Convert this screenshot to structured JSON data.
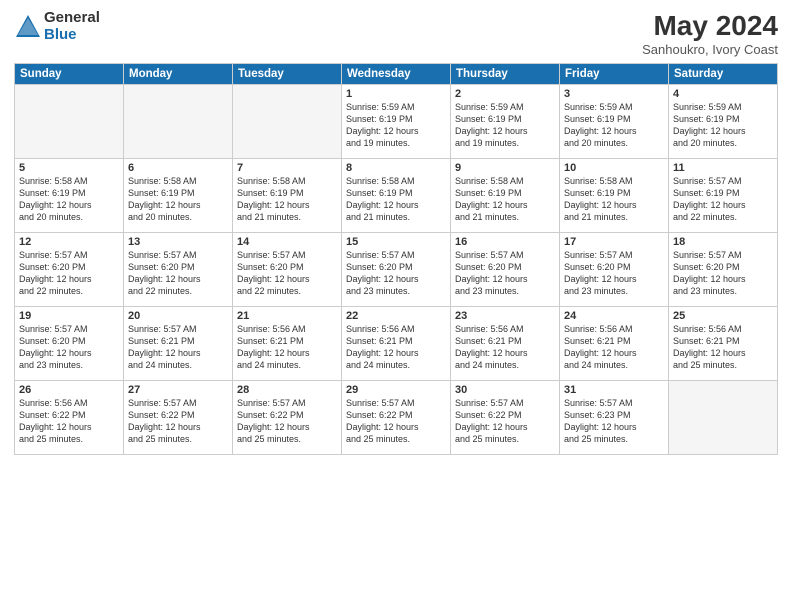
{
  "logo": {
    "general": "General",
    "blue": "Blue"
  },
  "title": "May 2024",
  "subtitle": "Sanhoukro, Ivory Coast",
  "days_header": [
    "Sunday",
    "Monday",
    "Tuesday",
    "Wednesday",
    "Thursday",
    "Friday",
    "Saturday"
  ],
  "weeks": [
    [
      {
        "num": "",
        "info": ""
      },
      {
        "num": "",
        "info": ""
      },
      {
        "num": "",
        "info": ""
      },
      {
        "num": "1",
        "info": "Sunrise: 5:59 AM\nSunset: 6:19 PM\nDaylight: 12 hours\nand 19 minutes."
      },
      {
        "num": "2",
        "info": "Sunrise: 5:59 AM\nSunset: 6:19 PM\nDaylight: 12 hours\nand 19 minutes."
      },
      {
        "num": "3",
        "info": "Sunrise: 5:59 AM\nSunset: 6:19 PM\nDaylight: 12 hours\nand 20 minutes."
      },
      {
        "num": "4",
        "info": "Sunrise: 5:59 AM\nSunset: 6:19 PM\nDaylight: 12 hours\nand 20 minutes."
      }
    ],
    [
      {
        "num": "5",
        "info": "Sunrise: 5:58 AM\nSunset: 6:19 PM\nDaylight: 12 hours\nand 20 minutes."
      },
      {
        "num": "6",
        "info": "Sunrise: 5:58 AM\nSunset: 6:19 PM\nDaylight: 12 hours\nand 20 minutes."
      },
      {
        "num": "7",
        "info": "Sunrise: 5:58 AM\nSunset: 6:19 PM\nDaylight: 12 hours\nand 21 minutes."
      },
      {
        "num": "8",
        "info": "Sunrise: 5:58 AM\nSunset: 6:19 PM\nDaylight: 12 hours\nand 21 minutes."
      },
      {
        "num": "9",
        "info": "Sunrise: 5:58 AM\nSunset: 6:19 PM\nDaylight: 12 hours\nand 21 minutes."
      },
      {
        "num": "10",
        "info": "Sunrise: 5:58 AM\nSunset: 6:19 PM\nDaylight: 12 hours\nand 21 minutes."
      },
      {
        "num": "11",
        "info": "Sunrise: 5:57 AM\nSunset: 6:19 PM\nDaylight: 12 hours\nand 22 minutes."
      }
    ],
    [
      {
        "num": "12",
        "info": "Sunrise: 5:57 AM\nSunset: 6:20 PM\nDaylight: 12 hours\nand 22 minutes."
      },
      {
        "num": "13",
        "info": "Sunrise: 5:57 AM\nSunset: 6:20 PM\nDaylight: 12 hours\nand 22 minutes."
      },
      {
        "num": "14",
        "info": "Sunrise: 5:57 AM\nSunset: 6:20 PM\nDaylight: 12 hours\nand 22 minutes."
      },
      {
        "num": "15",
        "info": "Sunrise: 5:57 AM\nSunset: 6:20 PM\nDaylight: 12 hours\nand 23 minutes."
      },
      {
        "num": "16",
        "info": "Sunrise: 5:57 AM\nSunset: 6:20 PM\nDaylight: 12 hours\nand 23 minutes."
      },
      {
        "num": "17",
        "info": "Sunrise: 5:57 AM\nSunset: 6:20 PM\nDaylight: 12 hours\nand 23 minutes."
      },
      {
        "num": "18",
        "info": "Sunrise: 5:57 AM\nSunset: 6:20 PM\nDaylight: 12 hours\nand 23 minutes."
      }
    ],
    [
      {
        "num": "19",
        "info": "Sunrise: 5:57 AM\nSunset: 6:20 PM\nDaylight: 12 hours\nand 23 minutes."
      },
      {
        "num": "20",
        "info": "Sunrise: 5:57 AM\nSunset: 6:21 PM\nDaylight: 12 hours\nand 24 minutes."
      },
      {
        "num": "21",
        "info": "Sunrise: 5:56 AM\nSunset: 6:21 PM\nDaylight: 12 hours\nand 24 minutes."
      },
      {
        "num": "22",
        "info": "Sunrise: 5:56 AM\nSunset: 6:21 PM\nDaylight: 12 hours\nand 24 minutes."
      },
      {
        "num": "23",
        "info": "Sunrise: 5:56 AM\nSunset: 6:21 PM\nDaylight: 12 hours\nand 24 minutes."
      },
      {
        "num": "24",
        "info": "Sunrise: 5:56 AM\nSunset: 6:21 PM\nDaylight: 12 hours\nand 24 minutes."
      },
      {
        "num": "25",
        "info": "Sunrise: 5:56 AM\nSunset: 6:21 PM\nDaylight: 12 hours\nand 25 minutes."
      }
    ],
    [
      {
        "num": "26",
        "info": "Sunrise: 5:56 AM\nSunset: 6:22 PM\nDaylight: 12 hours\nand 25 minutes."
      },
      {
        "num": "27",
        "info": "Sunrise: 5:57 AM\nSunset: 6:22 PM\nDaylight: 12 hours\nand 25 minutes."
      },
      {
        "num": "28",
        "info": "Sunrise: 5:57 AM\nSunset: 6:22 PM\nDaylight: 12 hours\nand 25 minutes."
      },
      {
        "num": "29",
        "info": "Sunrise: 5:57 AM\nSunset: 6:22 PM\nDaylight: 12 hours\nand 25 minutes."
      },
      {
        "num": "30",
        "info": "Sunrise: 5:57 AM\nSunset: 6:22 PM\nDaylight: 12 hours\nand 25 minutes."
      },
      {
        "num": "31",
        "info": "Sunrise: 5:57 AM\nSunset: 6:23 PM\nDaylight: 12 hours\nand 25 minutes."
      },
      {
        "num": "",
        "info": ""
      }
    ]
  ]
}
